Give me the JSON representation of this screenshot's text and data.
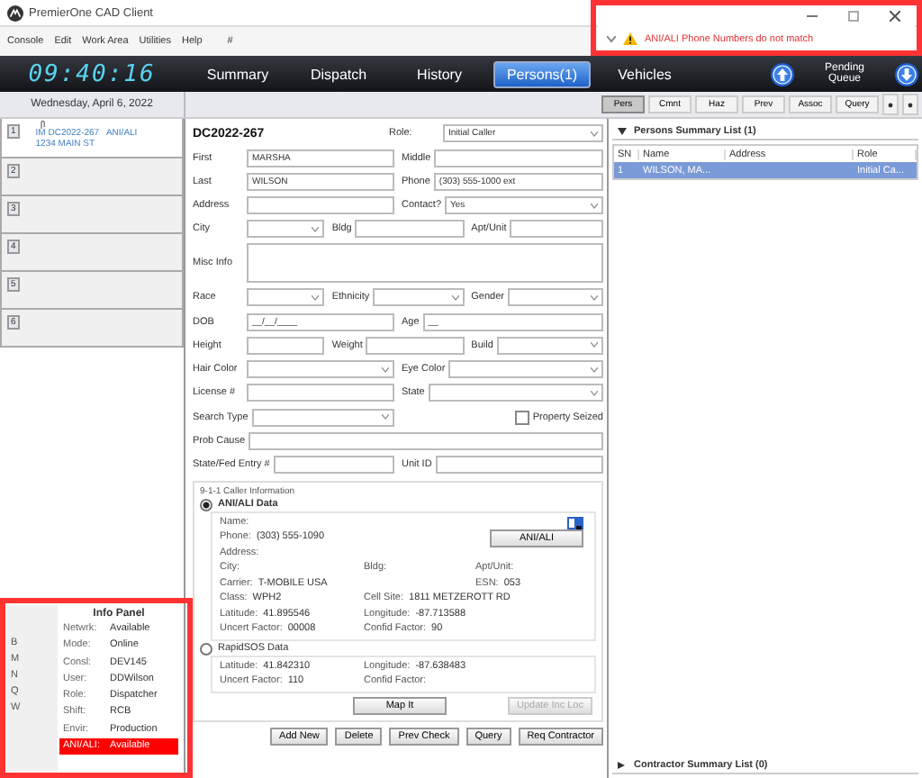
{
  "window": {
    "title": "PremierOne CAD Client"
  },
  "menu": [
    "Console",
    "Edit",
    "Work Area",
    "Utilities",
    "Help"
  ],
  "command_prompt": "#",
  "alert": {
    "message": "ANI/ALI Phone Numbers do not match"
  },
  "clock": "09:40:16",
  "nav_tabs": [
    {
      "label": "Summary",
      "selected": false
    },
    {
      "label": "Dispatch",
      "selected": false
    },
    {
      "label": "History",
      "selected": false
    },
    {
      "label": "Persons(1)",
      "selected": true
    },
    {
      "label": "Vehicles",
      "selected": false
    }
  ],
  "pending_queue": "Pending Queue",
  "date": "Wednesday, April 6, 2022",
  "sub_tabs": [
    {
      "label": "Pers",
      "selected": true
    },
    {
      "label": "Cmnt",
      "selected": false
    },
    {
      "label": "Haz",
      "selected": false
    },
    {
      "label": "Prev",
      "selected": false
    },
    {
      "label": "Assoc",
      "selected": false
    },
    {
      "label": "Query",
      "selected": false
    }
  ],
  "incident_slots": [
    {
      "number": "1",
      "lines": [
        "IM DC2022-267   ANI/ALI",
        "1234 MAIN ST"
      ]
    },
    {
      "number": "2"
    },
    {
      "number": "3"
    },
    {
      "number": "4"
    },
    {
      "number": "5"
    },
    {
      "number": "6"
    }
  ],
  "info_panel": {
    "letters": [
      "B",
      "M",
      "N",
      "Q",
      "W"
    ],
    "title": "Info Panel",
    "rows": [
      {
        "label": "Netwrk:",
        "value": "Available",
        "alert": false
      },
      {
        "label": "Mode:",
        "value": "Online",
        "alert": false
      },
      {
        "label": "Consl:",
        "value": "DEV145",
        "alert": false
      },
      {
        "label": "User:",
        "value": "DDWilson",
        "alert": false
      },
      {
        "label": "Role:",
        "value": "Dispatcher",
        "alert": false
      },
      {
        "label": "Shift:",
        "value": "RCB",
        "alert": false
      },
      {
        "label": "Envir:",
        "value": "Production",
        "alert": false
      },
      {
        "label": "ANI/ALI:",
        "value": "Available",
        "alert": true
      }
    ]
  },
  "form": {
    "incident_id": "DC2022-267",
    "rows": [
      {
        "fields": [
          {
            "label": "Role:",
            "kind": "select",
            "value": "Initial Caller"
          }
        ]
      },
      {
        "fields": [
          {
            "label": "First",
            "kind": "text",
            "value": "MARSHA"
          },
          {
            "label": "Middle",
            "kind": "text"
          }
        ]
      },
      {
        "fields": [
          {
            "label": "Last",
            "kind": "text",
            "value": "WILSON"
          },
          {
            "label": "Phone",
            "kind": "text",
            "value": "(303) 555-1000 ext"
          }
        ]
      },
      {
        "fields": [
          {
            "label": "Address",
            "kind": "text"
          },
          {
            "label": "Contact?",
            "kind": "select",
            "value": "Yes"
          }
        ]
      },
      {
        "fields": [
          {
            "label": "City",
            "kind": "select"
          },
          {
            "label": "Bldg",
            "kind": "text"
          },
          {
            "label": "Apt/Unit",
            "kind": "text"
          }
        ]
      },
      {
        "fields": [
          {
            "label": "Misc Info",
            "kind": "textarea"
          }
        ]
      },
      {
        "fields": [
          {
            "label": "Race",
            "kind": "select"
          },
          {
            "label": "Ethnicity",
            "kind": "select"
          },
          {
            "label": "Gender",
            "kind": "select"
          }
        ]
      },
      {
        "fields": [
          {
            "label": "DOB",
            "kind": "text",
            "value": "__/__/____"
          },
          {
            "label": "Age",
            "kind": "text",
            "value": "__"
          }
        ]
      },
      {
        "fields": [
          {
            "label": "Height",
            "kind": "text"
          },
          {
            "label": "Weight",
            "kind": "text"
          },
          {
            "label": "Build",
            "kind": "select"
          }
        ]
      },
      {
        "fields": [
          {
            "label": "Hair Color",
            "kind": "select"
          },
          {
            "label": "Eye Color",
            "kind": "select"
          }
        ]
      },
      {
        "fields": [
          {
            "label": "License #",
            "kind": "text"
          },
          {
            "label": "State",
            "kind": "select"
          }
        ]
      },
      {
        "fields": [
          {
            "label": "Search Type",
            "kind": "select"
          },
          {
            "label": "Property Seized",
            "kind": "checkbox",
            "checked": false
          }
        ]
      },
      {
        "fields": [
          {
            "label": "Prob Cause",
            "kind": "text"
          }
        ]
      },
      {
        "fields": [
          {
            "label": "State/Fed Entry #",
            "kind": "text"
          },
          {
            "label": "Unit ID",
            "kind": "text"
          }
        ]
      }
    ]
  },
  "caller_info": {
    "title": "9-1-1 Caller Information",
    "sources": [
      {
        "label": "ANI/ALI Data",
        "selected": true,
        "rows": [
          {
            "left": {
              "label": "Name:"
            }
          },
          {
            "left": {
              "label": "Phone:",
              "value": "(303) 555-1090"
            }
          },
          {
            "left": {
              "label": "Address:"
            }
          },
          {
            "left": {
              "label": "City:"
            },
            "middle": {
              "label": "Bldg:"
            },
            "right": {
              "label": "Apt/Unit:"
            }
          },
          {
            "left": {
              "label": "Carrier:",
              "value": "T-MOBILE USA"
            },
            "right": {
              "label": "ESN:",
              "value": "053"
            }
          },
          {
            "left": {
              "label": "Class:",
              "value": "WPH2"
            },
            "middle": {
              "label": "Cell Site:",
              "value": "1811 METZEROTT RD"
            }
          },
          {
            "left": {
              "label": "Latitude:",
              "value": "41.895546"
            },
            "middle": {
              "label": "Longitude:",
              "value": "-87.713588"
            }
          },
          {
            "left": {
              "label": "Uncert Factor:",
              "value": "00008"
            },
            "middle": {
              "label": "Confid Factor:",
              "value": "90"
            }
          }
        ],
        "button": "ANI/ALI"
      },
      {
        "label": "RapidSOS Data",
        "selected": false,
        "rows": [
          {
            "left": {
              "label": "Latitude:",
              "value": "41.842310"
            },
            "middle": {
              "label": "Longitude:",
              "value": "-87.638483"
            }
          },
          {
            "left": {
              "label": "Uncert Factor:",
              "value": "110"
            },
            "middle": {
              "label": "Confid Factor:"
            }
          }
        ]
      }
    ],
    "buttons": [
      {
        "label": "Map It",
        "disabled": false
      },
      {
        "label": "Update Inc Loc",
        "disabled": true
      }
    ]
  },
  "action_buttons": [
    "Add New",
    "Delete",
    "Prev Check",
    "Query",
    "Req Contractor"
  ],
  "persons_list": {
    "title": "Persons Summary List (1)",
    "expanded": true,
    "columns": [
      "SN",
      "Name",
      "Address",
      "Role"
    ],
    "rows": [
      {
        "cells": [
          "1",
          "WILSON, MA...",
          "",
          "Initial Ca..."
        ],
        "selected": true
      }
    ]
  },
  "contractor_list": {
    "title": "Contractor Summary List (0)",
    "expanded": false
  }
}
